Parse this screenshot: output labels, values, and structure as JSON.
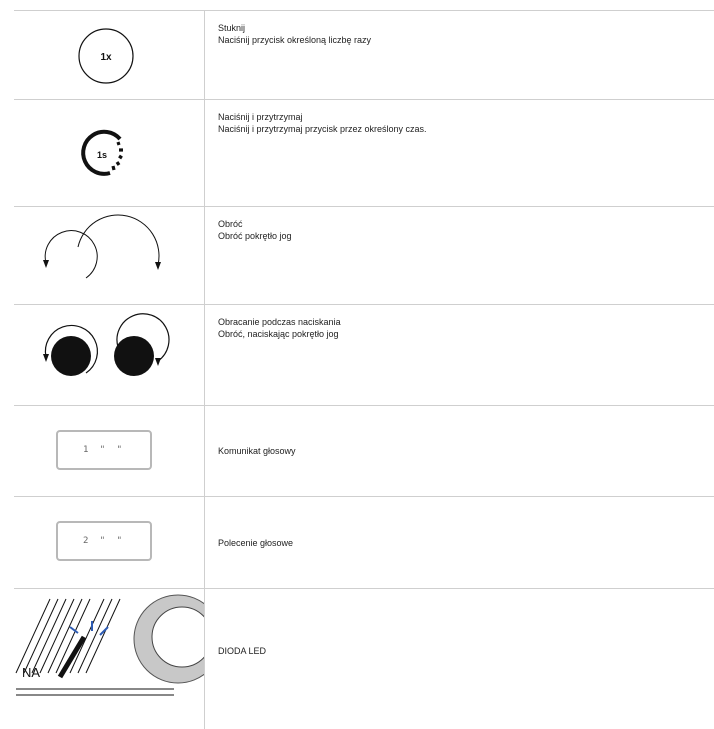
{
  "rows": [
    {
      "icon": "tap-1x-icon",
      "badge": "1x",
      "title": "Stuknij",
      "desc": "Naciśnij przycisk określoną liczbę razy"
    },
    {
      "icon": "press-hold-1s-icon",
      "badge": "1s",
      "title": "Naciśnij i przytrzymaj",
      "desc": "Naciśnij i przytrzymaj przycisk przez określony czas."
    },
    {
      "icon": "rotate-knob-icon",
      "title": "Obróć",
      "desc": "Obróć pokrętło jog"
    },
    {
      "icon": "rotate-while-pressing-icon",
      "title": "Obracanie podczas naciskania",
      "desc": "Obróć, naciskając pokrętło jog"
    },
    {
      "icon": "display-message-1-icon",
      "lcd": "1 \" \"",
      "title": "Komunikat głosowy"
    },
    {
      "icon": "display-message-2-icon",
      "lcd": "2 \" \"",
      "title": "Polecenie głosowe"
    },
    {
      "icon": "led-indicator-icon",
      "led_label": "NA",
      "title": "DIODA LED"
    }
  ]
}
